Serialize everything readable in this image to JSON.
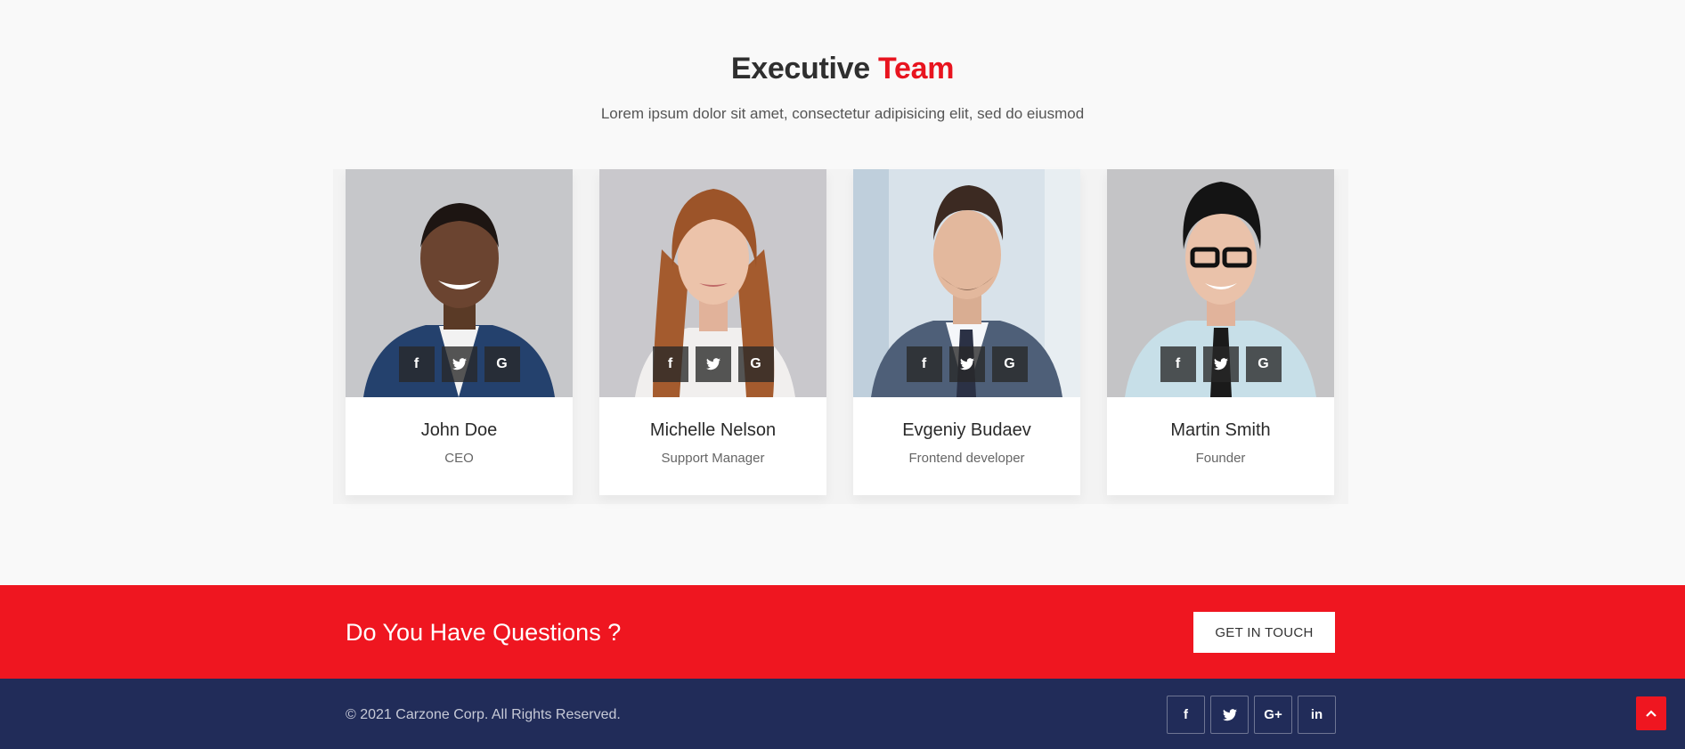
{
  "team": {
    "title_prefix": "Executive",
    "title_accent": "Team",
    "subtitle": "Lorem ipsum dolor sit amet, consectetur adipisicing elit, sed do eiusmod",
    "members": [
      {
        "name": "John Doe",
        "role": "CEO"
      },
      {
        "name": "Michelle Nelson",
        "role": "Support Manager"
      },
      {
        "name": "Evgeniy Budaev",
        "role": "Frontend developer"
      },
      {
        "name": "Martin Smith",
        "role": "Founder"
      }
    ],
    "social_icons": [
      "facebook-icon",
      "twitter-icon",
      "google-icon"
    ],
    "social_glyphs": {
      "facebook": "f",
      "twitter": "🐦",
      "google": "G"
    }
  },
  "cta": {
    "title": "Do You Have Questions ?",
    "button_label": "GET IN TOUCH"
  },
  "footer": {
    "copyright": "© 2021 Carzone Corp. All Rights Reserved.",
    "social_icons": [
      "facebook-icon",
      "twitter-icon",
      "google-plus-icon",
      "linkedin-icon"
    ],
    "social_glyphs": {
      "facebook": "f",
      "twitter": "🐦",
      "google_plus": "G+",
      "linkedin": "in"
    }
  },
  "colors": {
    "accent": "#ef1620",
    "footer_bg": "#212c59",
    "page_bg": "#f9f9f9"
  }
}
